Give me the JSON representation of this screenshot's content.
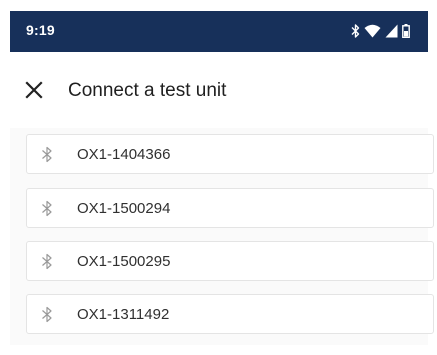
{
  "status_bar": {
    "time": "9:19",
    "icons": [
      "bluetooth-icon",
      "wifi-icon",
      "cell-signal-icon",
      "battery-icon"
    ],
    "background": "#17305a"
  },
  "header": {
    "close_icon": "close-icon",
    "title": "Connect a test unit"
  },
  "units": [
    {
      "name": "OX1-1404366",
      "icon": "bluetooth-icon"
    },
    {
      "name": "OX1-1500294",
      "icon": "bluetooth-icon"
    },
    {
      "name": "OX1-1500295",
      "icon": "bluetooth-icon"
    },
    {
      "name": "OX1-1311492",
      "icon": "bluetooth-icon"
    }
  ]
}
